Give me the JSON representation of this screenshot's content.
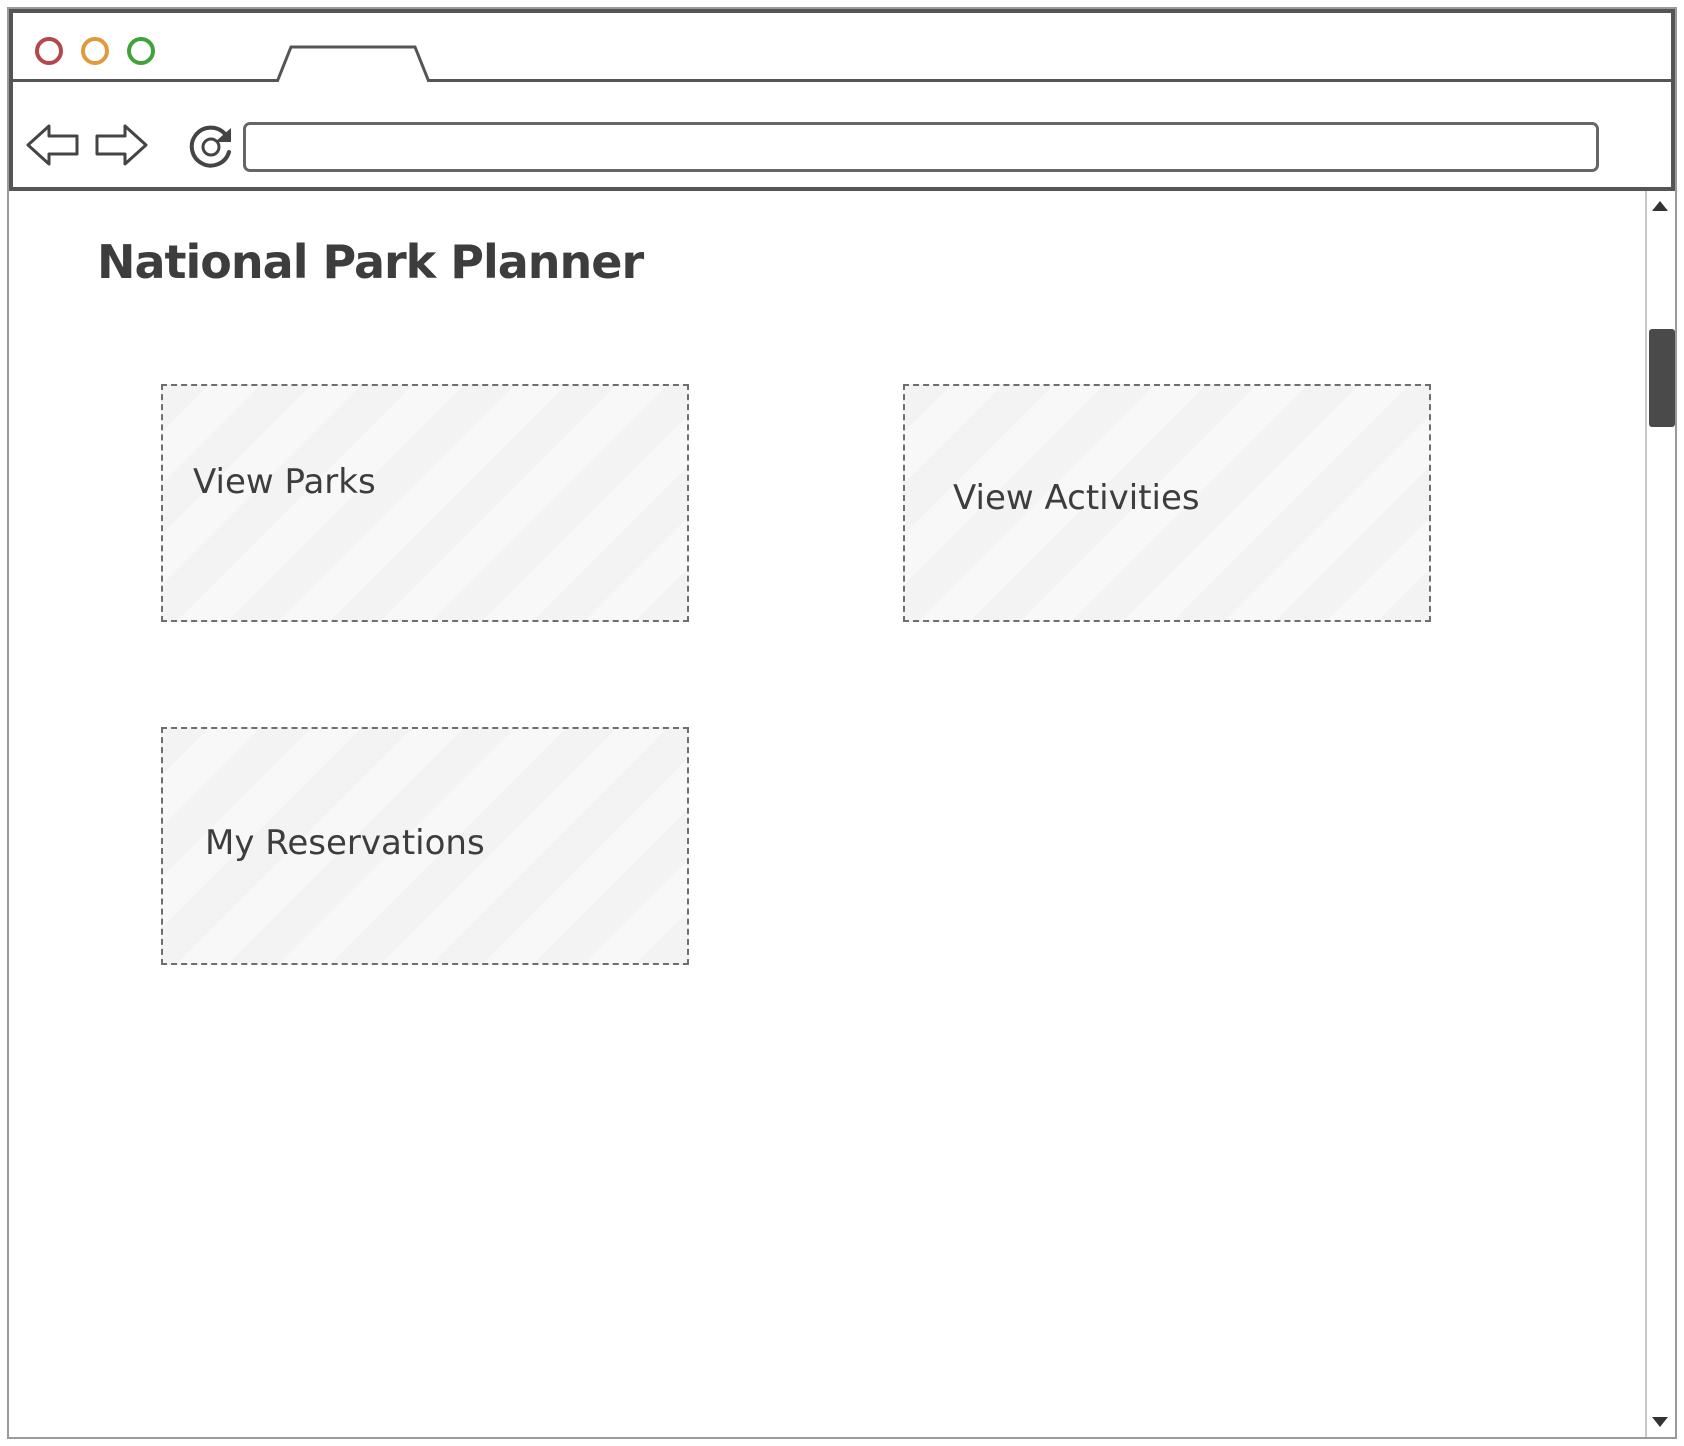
{
  "browser": {
    "window_controls": [
      "close",
      "minimize",
      "maximize"
    ],
    "address_bar": {
      "value": "",
      "placeholder": ""
    },
    "nav_icons": [
      "back-arrow-icon",
      "forward-arrow-icon",
      "reload-icon"
    ]
  },
  "page": {
    "title": "National Park Planner",
    "cards": [
      {
        "label": "View Parks"
      },
      {
        "label": "View Activities"
      },
      {
        "label": "My Reservations"
      }
    ]
  },
  "colors": {
    "close": "#b5464b",
    "minimize": "#e09a3c",
    "maximize": "#3fa33a",
    "outline": "#555555",
    "card_border": "#6e6e6e",
    "card_fill": "#f3f3f3"
  }
}
